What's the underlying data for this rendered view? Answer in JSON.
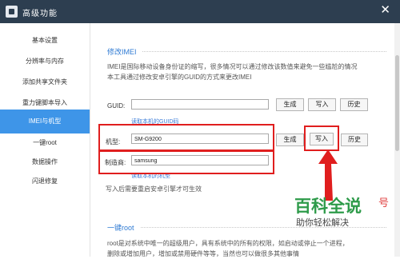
{
  "window": {
    "title": "高级功能",
    "close_glyph": "✕"
  },
  "sidebar": {
    "items": [
      {
        "label": "基本设置"
      },
      {
        "label": "分辨率与内存"
      },
      {
        "label": "添加共享文件夹"
      },
      {
        "label": "重力键脚本导入"
      },
      {
        "label": "IMEI与机型"
      },
      {
        "label": "一键root"
      },
      {
        "label": "数据操作"
      },
      {
        "label": "闪退修复"
      }
    ],
    "active_index": 4
  },
  "imei": {
    "title": "修改IMEI",
    "desc_line1": "IMEI是国际移动设备身份证的缩写，很多情况可以通过修改该数值来避免一些尴尬的情况",
    "desc_line2": "本工具通过修改安卓引擎的GUID的方式来更改IMEI",
    "guid_label": "GUID:",
    "guid_value": "",
    "generate_label": "生成",
    "write_label": "写入",
    "history_label": "历史",
    "read_guid_link": "读取本机的GUID码",
    "model_label": "机型:",
    "model_value": "SM-G9200",
    "maker_label": "制造商:",
    "maker_value": "samsung",
    "read_model_link": "读取本机的机型",
    "restart_note": "写入后需要重启安卓引擎才可生效"
  },
  "root": {
    "title": "一键root",
    "desc_line1": "root是对系统中唯一的超级用户，具有系统中的所有的权限，如启动或停止一个进程，",
    "desc_line2": "删除或增加用户，增加或禁用硬件等等，当然也可以做很多其他事情"
  },
  "watermark": {
    "main": "百科全说",
    "sub": "助你轻松解决",
    "side": "号"
  },
  "colors": {
    "titlebar": "#2d3e50",
    "active_tab": "#3e95e8",
    "accent_red": "#e01e1e",
    "section_title": "#2e7ad3"
  },
  "icons": {
    "app": "app-icon",
    "close": "close-icon",
    "arrow": "red-arrow-annotation"
  }
}
